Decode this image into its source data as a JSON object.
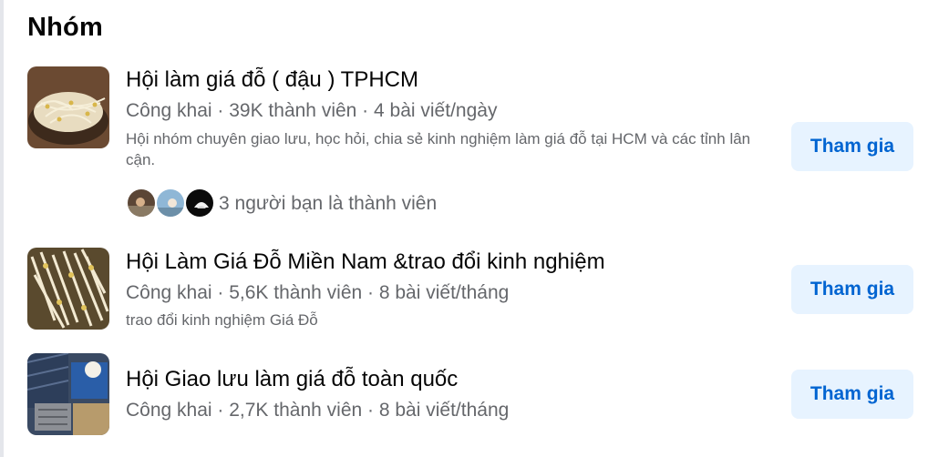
{
  "section": {
    "title": "Nhóm"
  },
  "groups": [
    {
      "name": "Hội làm giá đỗ ( đậu ) TPHCM",
      "privacy": "Công khai",
      "members": "39K thành viên",
      "posts": "4 bài viết/ngày",
      "description": "Hội nhóm chuyên giao lưu, học hỏi, chia sẻ kinh nghiệm làm giá đỗ tại HCM và các tỉnh lân cận.",
      "friends_text": "3 người bạn là thành viên",
      "join_label": "Tham gia"
    },
    {
      "name": "Hội Làm Giá Đỗ Miền Nam &trao đổi kinh nghiệm",
      "privacy": "Công khai",
      "members": "5,6K thành viên",
      "posts": "8 bài viết/tháng",
      "description": "trao đổi kinh nghiệm Giá Đỗ",
      "join_label": "Tham gia"
    },
    {
      "name": "Hội Giao lưu làm giá đỗ toàn quốc",
      "privacy": "Công khai",
      "members": "2,7K thành viên",
      "posts": "8 bài viết/tháng",
      "join_label": "Tham gia"
    }
  ],
  "meta_separator": " · ",
  "colors": {
    "accent": "#0064d1",
    "button_bg": "#e7f3ff",
    "secondary_text": "#65676b"
  }
}
